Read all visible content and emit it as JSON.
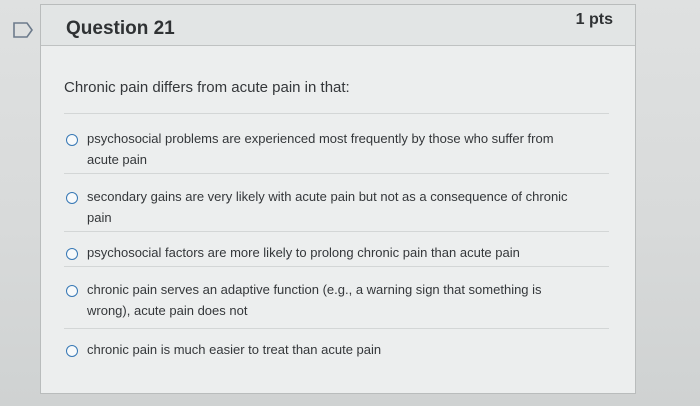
{
  "question": {
    "title": "Question 21",
    "points": "1 pts",
    "prompt": "Chronic pain differs from acute pain in that:",
    "answers": [
      "psychosocial problems are experienced most frequently by those who suffer from acute pain",
      "secondary gains are very likely with acute pain but not as a consequence of chronic pain",
      "psychosocial factors are more likely to prolong chronic pain than acute pain",
      "chronic pain serves an adaptive function (e.g., a warning sign that something is wrong), acute pain does not",
      "chronic pain is much easier to treat than acute pain"
    ]
  },
  "icons": {
    "flag": "flag-icon",
    "radio": "radio-button-icon"
  },
  "colors": {
    "accent": "#3778b5",
    "text": "#34373a",
    "background": "#eceeee"
  }
}
